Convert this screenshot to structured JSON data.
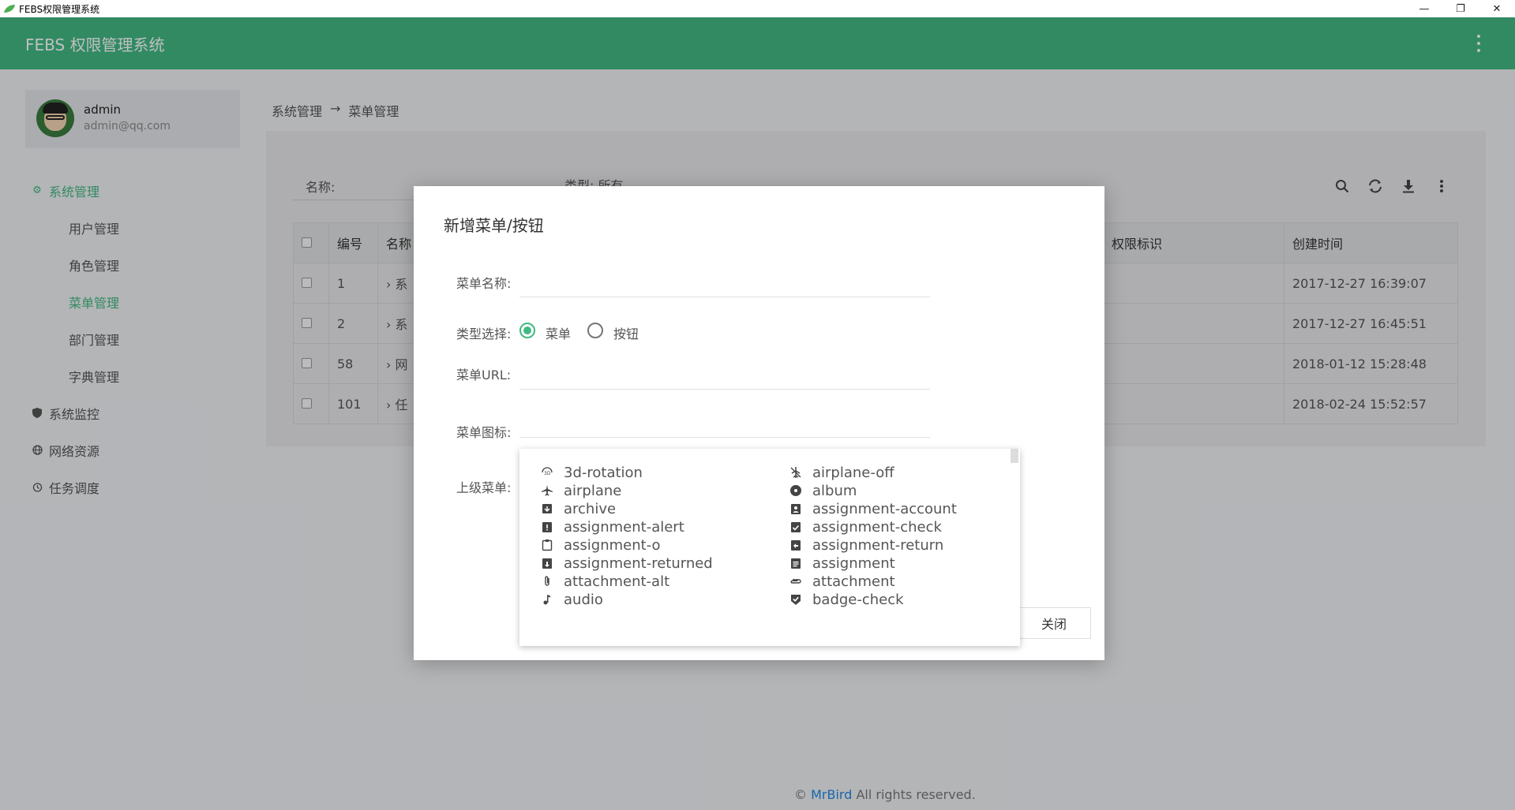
{
  "window": {
    "title": "FEBS权限管理系统",
    "minimize_icon": "minimize-icon",
    "restore_icon": "restore-icon",
    "close_icon": "close-icon"
  },
  "header": {
    "title": "FEBS 权限管理系统",
    "more_icon": "more-vert-icon",
    "brand_color": "#42b983"
  },
  "user": {
    "name": "admin",
    "email": "admin@qq.com"
  },
  "sidebar": {
    "groups": [
      {
        "label": "系统管理",
        "icon": "gear-icon",
        "active": true,
        "items": [
          {
            "label": "用户管理",
            "active": false
          },
          {
            "label": "角色管理",
            "active": false
          },
          {
            "label": "菜单管理",
            "active": true
          },
          {
            "label": "部门管理",
            "active": false
          },
          {
            "label": "字典管理",
            "active": false
          }
        ]
      },
      {
        "label": "系统监控",
        "icon": "shield-icon",
        "active": false
      },
      {
        "label": "网络资源",
        "icon": "globe-icon",
        "active": false
      },
      {
        "label": "任务调度",
        "icon": "alarm-icon",
        "active": false
      }
    ]
  },
  "breadcrumb": {
    "parent": "系统管理",
    "separator": "→",
    "current": "菜单管理"
  },
  "filters": {
    "name_label": "名称:",
    "type_label": "类型: 所有"
  },
  "toolbar": {
    "icons": [
      "search-icon",
      "refresh-icon",
      "download-icon",
      "more-vert-icon"
    ]
  },
  "table": {
    "headers": {
      "id": "编号",
      "name": "名称",
      "perm": "权限标识",
      "created": "创建时间"
    },
    "rows": [
      {
        "id": "1",
        "name": "系",
        "created": "2017-12-27 16:39:07"
      },
      {
        "id": "2",
        "name": "系",
        "created": "2017-12-27 16:45:51"
      },
      {
        "id": "58",
        "name": "网",
        "created": "2018-01-12 15:28:48"
      },
      {
        "id": "101",
        "name": "任",
        "created": "2018-02-24 15:52:57"
      }
    ]
  },
  "modal": {
    "title": "新增菜单/按钮",
    "menu_name_label": "菜单名称:",
    "type_label": "类型选择:",
    "type_option_menu": "菜单",
    "type_option_button": "按钮",
    "url_label": "菜单URL:",
    "icon_label": "菜单图标:",
    "parent_label": "上级菜单:",
    "close_button": "关闭"
  },
  "icon_list": [
    {
      "name": "3d-rotation",
      "icon": "3d-rotation-icon"
    },
    {
      "name": "airplane-off",
      "icon": "airplane-off-icon"
    },
    {
      "name": "airplane",
      "icon": "airplane-icon"
    },
    {
      "name": "album",
      "icon": "album-icon"
    },
    {
      "name": "archive",
      "icon": "archive-icon"
    },
    {
      "name": "assignment-account",
      "icon": "assignment-account-icon"
    },
    {
      "name": "assignment-alert",
      "icon": "assignment-alert-icon"
    },
    {
      "name": "assignment-check",
      "icon": "assignment-check-icon"
    },
    {
      "name": "assignment-o",
      "icon": "assignment-o-icon"
    },
    {
      "name": "assignment-return",
      "icon": "assignment-return-icon"
    },
    {
      "name": "assignment-returned",
      "icon": "assignment-returned-icon"
    },
    {
      "name": "assignment",
      "icon": "assignment-icon"
    },
    {
      "name": "attachment-alt",
      "icon": "attachment-alt-icon"
    },
    {
      "name": "attachment",
      "icon": "attachment-icon"
    },
    {
      "name": "audio",
      "icon": "audio-icon"
    },
    {
      "name": "badge-check",
      "icon": "badge-check-icon"
    }
  ],
  "footer": {
    "prefix": "©",
    "link": "MrBird",
    "suffix": "All rights reserved."
  }
}
